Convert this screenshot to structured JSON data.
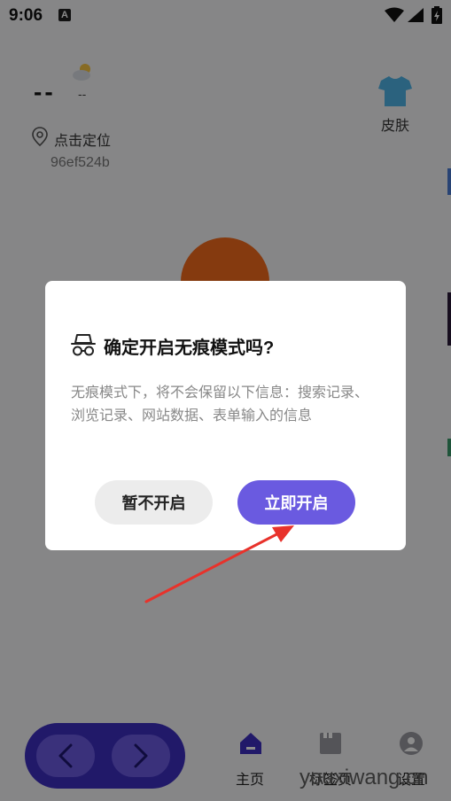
{
  "status_bar": {
    "time": "9:06",
    "notification_icon": "A"
  },
  "weather": {
    "temperature": "--",
    "temp_secondary": "--",
    "location_label": "点击定位",
    "device_code": "96ef524b"
  },
  "skin": {
    "label": "皮肤"
  },
  "dialog": {
    "title": "确定开启无痕模式吗?",
    "body": "无痕模式下，将不会保留以下信息：搜索记录、浏览记录、网站数据、表单输入的信息",
    "cancel_label": "暂不开启",
    "confirm_label": "立即开启"
  },
  "bottom_nav": {
    "tabs": [
      {
        "label": "主页"
      },
      {
        "label": "标签页"
      },
      {
        "label": "设置"
      }
    ]
  },
  "watermark": "youxiwang.cn",
  "colors": {
    "accent": "#6a5ae0",
    "nav_dark": "#3c2fc0",
    "logo_orange": "#f26b1d",
    "arrow_red": "#e8322b"
  }
}
